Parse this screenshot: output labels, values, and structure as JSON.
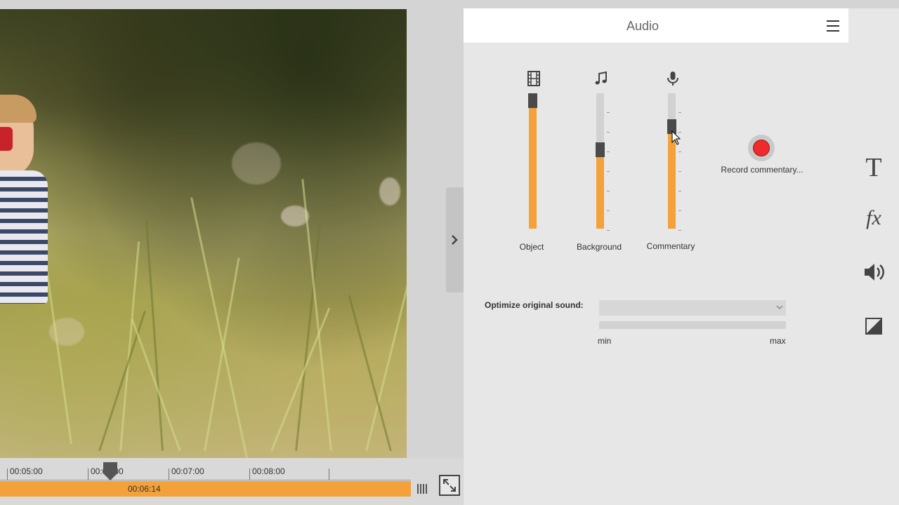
{
  "panel": {
    "title": "Audio",
    "menu_icon": "hamburger-menu-icon"
  },
  "mixer": {
    "channels": [
      {
        "label": "Object",
        "icon": "film-strip-icon",
        "level": 0.9
      },
      {
        "label": "Background",
        "icon": "music-note-icon",
        "level": 0.53
      },
      {
        "label": "Commentary",
        "icon": "microphone-icon",
        "level": 0.7
      }
    ],
    "record_label": "Record commentary..."
  },
  "optimize": {
    "label": "Optimize original sound:",
    "select_value": "",
    "min_label": "min",
    "max_label": "max"
  },
  "timeline": {
    "ticks": [
      "00:05:00",
      "00:06:00",
      "00:07:00",
      "00:08:00"
    ],
    "current_time": "00:06:14"
  },
  "sidebar": {
    "items": [
      {
        "name": "text-tool-icon"
      },
      {
        "name": "effects-fx-icon"
      },
      {
        "name": "audio-speaker-icon"
      },
      {
        "name": "color-correction-icon"
      }
    ]
  },
  "colors": {
    "accent": "#f4a13a",
    "record": "#ee2a2a"
  }
}
